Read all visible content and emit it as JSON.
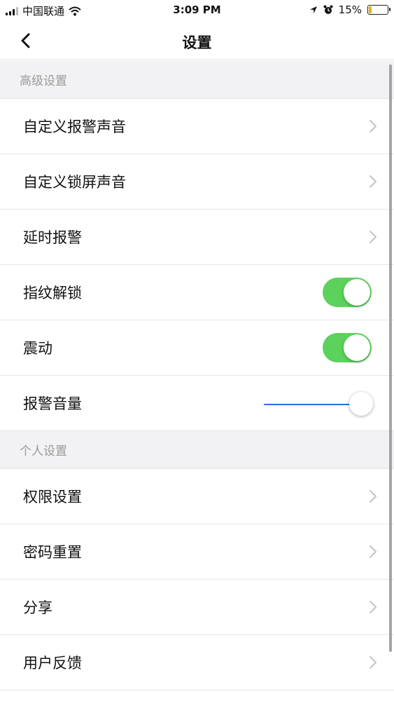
{
  "status_bar": {
    "carrier": "中国联通",
    "time": "3:09 PM",
    "battery_percent": "15%",
    "battery_level": 0.15,
    "icons": [
      "signal-icon",
      "wifi-icon",
      "location-icon",
      "alarm-icon",
      "battery-icon"
    ]
  },
  "nav": {
    "title": "设置",
    "back_icon": "chevron-left-icon"
  },
  "sections": [
    {
      "header": "高级设置",
      "rows": [
        {
          "label": "自定义报警声音",
          "control": "chevron"
        },
        {
          "label": "自定义锁屏声音",
          "control": "chevron"
        },
        {
          "label": "延时报警",
          "control": "chevron"
        },
        {
          "label": "指纹解锁",
          "control": "toggle",
          "on": true
        },
        {
          "label": "震动",
          "control": "toggle",
          "on": true
        },
        {
          "label": "报警音量",
          "control": "slider",
          "value": 1.0
        }
      ]
    },
    {
      "header": "个人设置",
      "rows": [
        {
          "label": "权限设置",
          "control": "chevron"
        },
        {
          "label": "密码重置",
          "control": "chevron"
        },
        {
          "label": "分享",
          "control": "chevron"
        },
        {
          "label": "用户反馈",
          "control": "chevron"
        }
      ]
    }
  ],
  "colors": {
    "toggle_on": "#5cd25c",
    "slider_fill": "#2b6be0",
    "section_bg": "#f2f2f4",
    "section_text": "#9a9a9a",
    "battery_low": "#e6b400"
  }
}
